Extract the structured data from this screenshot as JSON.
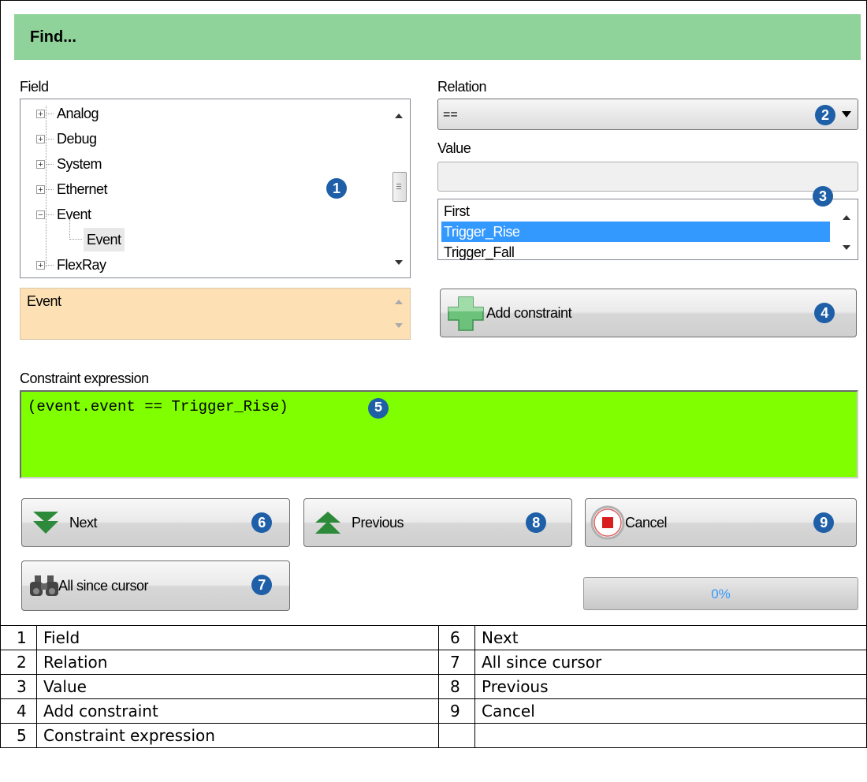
{
  "dialog": {
    "title": "Find..."
  },
  "field": {
    "label": "Field",
    "tree": [
      {
        "label": "Analog",
        "state": "collapsed"
      },
      {
        "label": "Debug",
        "state": "collapsed"
      },
      {
        "label": "System",
        "state": "collapsed"
      },
      {
        "label": "Ethernet",
        "state": "collapsed"
      },
      {
        "label": "Event",
        "state": "expanded"
      },
      {
        "label": "Event",
        "state": "child-selected"
      },
      {
        "label": "FlexRay",
        "state": "collapsed"
      }
    ],
    "description": "Event"
  },
  "relation": {
    "label": "Relation",
    "selected": "=="
  },
  "value": {
    "label": "Value",
    "input": "",
    "options": [
      "First",
      "Trigger_Rise",
      "Trigger_Fall"
    ],
    "selected_index": 1
  },
  "add_constraint": {
    "label": "Add constraint"
  },
  "constraint": {
    "label": "Constraint expression",
    "expression": "(event.event == Trigger_Rise)"
  },
  "buttons": {
    "next": "Next",
    "previous": "Previous",
    "cancel": "Cancel",
    "all_since_cursor": "All since cursor"
  },
  "progress": {
    "text": "0%",
    "value": 0
  },
  "badges": [
    "1",
    "2",
    "3",
    "4",
    "5",
    "6",
    "7",
    "8",
    "9"
  ],
  "legend": [
    {
      "n1": "1",
      "t1": "Field",
      "n2": "6",
      "t2": "Next"
    },
    {
      "n1": "2",
      "t1": "Relation",
      "n2": "7",
      "t2": "All since cursor"
    },
    {
      "n1": "3",
      "t1": "Value",
      "n2": "8",
      "t2": "Previous"
    },
    {
      "n1": "4",
      "t1": "Add constraint",
      "n2": "9",
      "t2": "Cancel"
    },
    {
      "n1": "5",
      "t1": "Constraint expression",
      "n2": "",
      "t2": ""
    }
  ],
  "colors": {
    "title_bar": "#8fd39a",
    "expression_bg": "#7fff00",
    "badge": "#1e5fa8",
    "selection": "#3399ff",
    "description_bg": "#fde0b4"
  }
}
